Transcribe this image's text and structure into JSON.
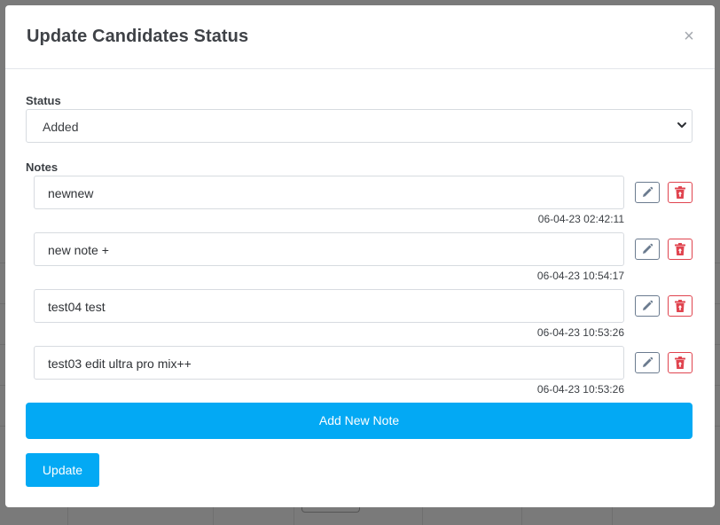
{
  "modal": {
    "title": "Update Candidates Status",
    "close_glyph": "×"
  },
  "status": {
    "label": "Status",
    "selected": "Added"
  },
  "notes": {
    "label": "Notes",
    "items": [
      {
        "text": "newnew",
        "timestamp": "06-04-23 02:42:11"
      },
      {
        "text": "new note +",
        "timestamp": "06-04-23 10:54:17"
      },
      {
        "text": "test04 test",
        "timestamp": "06-04-23 10:53:26"
      },
      {
        "text": "test03 edit ultra pro mix++",
        "timestamp": "06-04-23 10:53:26"
      }
    ]
  },
  "actions": {
    "add_note_label": "Add New Note",
    "update_label": "Update"
  },
  "colors": {
    "primary": "#03a9f4",
    "danger": "#e0444f",
    "secondary": "#6b7b8f"
  },
  "icons": {
    "edit": "pencil-icon",
    "delete": "trash-icon",
    "close": "close-icon",
    "select": "chevron-down-icon"
  }
}
